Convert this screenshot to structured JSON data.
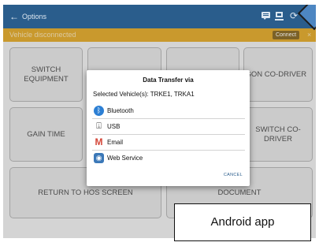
{
  "topbar": {
    "back_glyph": "←",
    "title": "Options",
    "icons": [
      "chat-icon",
      "computer-icon",
      "refresh-icon"
    ],
    "refresh_glyph": "⟳"
  },
  "status": {
    "text": "Vehicle disconnected",
    "connect_label": "Connect",
    "close_glyph": "×"
  },
  "tiles": [
    {
      "label": "SWITCH EQUIPMENT"
    },
    {
      "label": "LOGON CO-DRIVER"
    },
    {
      "label": "GAIN TIME"
    },
    {
      "label": "SWITCH CO-DRIVER"
    },
    {
      "label": "RETURN TO HOS SCREEN"
    },
    {
      "label": "DOCUMENT"
    }
  ],
  "dialog": {
    "title": "Data Transfer via",
    "selected_vehicles": "Selected Vehicle(s): TRKE1, TRKA1",
    "options": [
      {
        "label": "Bluetooth",
        "icon": "bluetooth-icon"
      },
      {
        "label": "USB",
        "icon": "usb-icon"
      },
      {
        "label": "Email",
        "icon": "gmail-icon"
      },
      {
        "label": "Web Service",
        "icon": "web-service-icon"
      }
    ],
    "cancel_label": "CANCEL"
  },
  "caption": "Android app",
  "colors": {
    "topbar": "#2a5d8c",
    "statusbar": "#e0ab33",
    "accent": "#2a5d8c"
  }
}
